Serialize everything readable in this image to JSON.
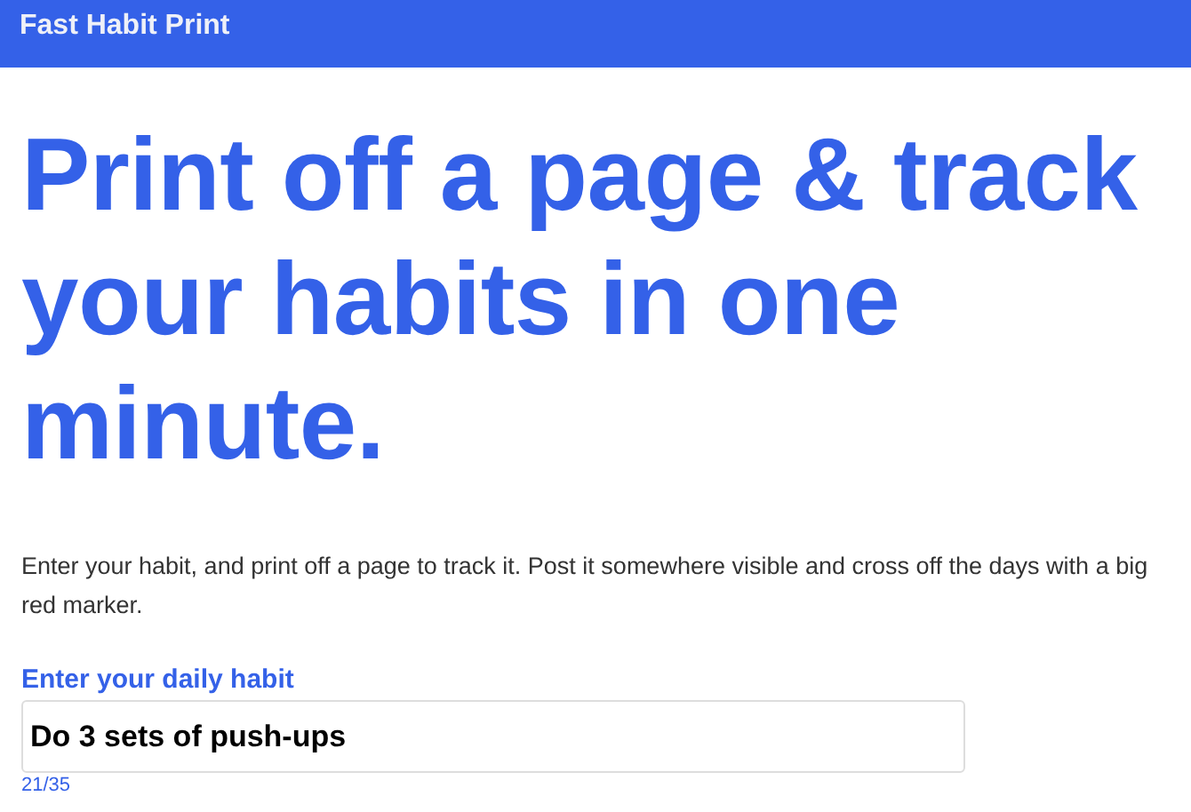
{
  "header": {
    "title": "Fast Habit Print"
  },
  "headline": "Print off a page & track your habits in one minute.",
  "intro": "Enter your habit, and print off a page to track it. Post it somewhere visible and cross off the days with a big red marker.",
  "habit_field": {
    "label": "Enter your daily habit",
    "value": "Do 3 sets of push-ups",
    "counter": "21/35"
  }
}
